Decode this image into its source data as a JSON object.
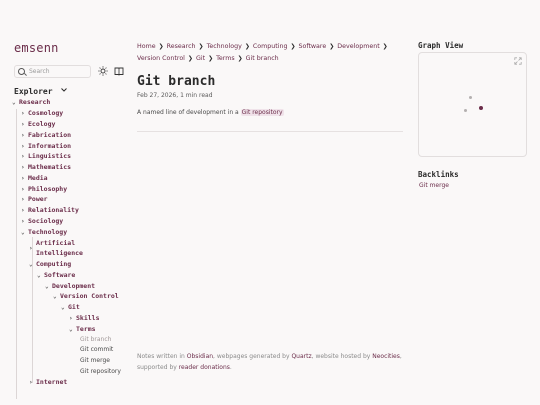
{
  "site": {
    "title": "emsenn"
  },
  "search": {
    "placeholder": "Search"
  },
  "explorer": {
    "title": "Explorer",
    "root": "Research",
    "top_items": [
      "Cosmology",
      "Ecology",
      "Fabrication",
      "Information",
      "Linguistics",
      "Mathematics",
      "Media",
      "Philosophy",
      "Power",
      "Relationality",
      "Sociology"
    ],
    "technology": "Technology",
    "ai_line1": "Artificial",
    "ai_line2": "Intelligence",
    "computing": "Computing",
    "software": "Software",
    "development": "Development",
    "version_control": "Version Control",
    "git": "Git",
    "skills": "Skills",
    "terms": "Terms",
    "terms_leaves": [
      "Git branch",
      "Git commit",
      "Git merge",
      "Git repository"
    ],
    "internet": "Internet"
  },
  "breadcrumb": {
    "items": [
      "Home",
      "Research",
      "Technology",
      "Computing",
      "Software",
      "Development",
      "Version Control",
      "Git",
      "Terms",
      "Git branch"
    ]
  },
  "page": {
    "title": "Git branch",
    "meta": "Feb 27, 2026, 1 min read",
    "desc_prefix": "A named line of development in a ",
    "desc_link": "Git repository"
  },
  "footer": {
    "p1": "Notes written in ",
    "l1": "Obsidian",
    "p2": ", webpages generated by ",
    "l2": "Quartz",
    "p3": ", website hosted by ",
    "l3": "Neocities",
    "p4": ",",
    "p5": "supported by ",
    "l4": "reader donations",
    "p6": "."
  },
  "graph": {
    "title": "Graph View"
  },
  "backlinks": {
    "title": "Backlinks",
    "items": [
      "Git merge"
    ]
  },
  "colors": {
    "accent": "#6b2d4a",
    "background": "#faf8f8",
    "highlight": "#f0e3ea"
  }
}
